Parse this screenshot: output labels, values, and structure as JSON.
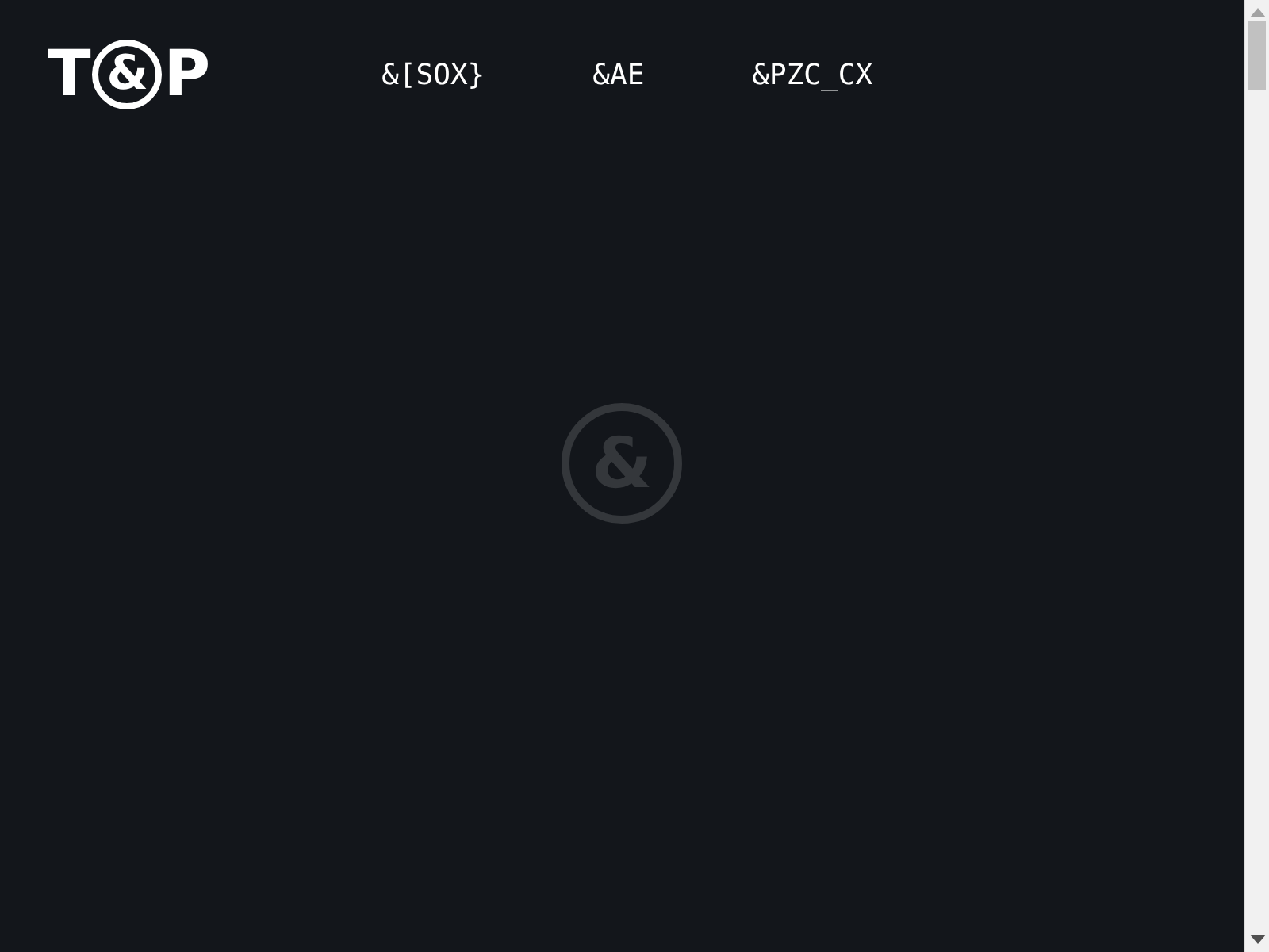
{
  "logo": {
    "left": "T",
    "mark": "&",
    "right": "P"
  },
  "nav": [
    {
      "label": "&[SOX}"
    },
    {
      "label": "&AE"
    },
    {
      "label": "&PZC_CX"
    }
  ],
  "loader": {
    "glyph": "&"
  }
}
